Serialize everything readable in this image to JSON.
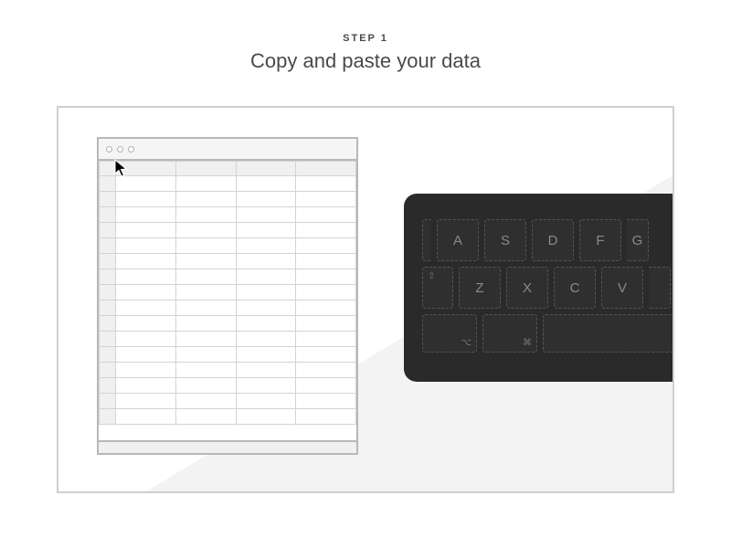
{
  "header": {
    "step_label": "STEP 1",
    "title": "Copy and paste your data"
  },
  "keyboard": {
    "row1": [
      "A",
      "S",
      "D",
      "F",
      "G"
    ],
    "row2_shift_symbol": "⇧",
    "row2": [
      "Z",
      "X",
      "C",
      "V"
    ],
    "option_symbol": "⌥",
    "command_symbol": "⌘"
  }
}
